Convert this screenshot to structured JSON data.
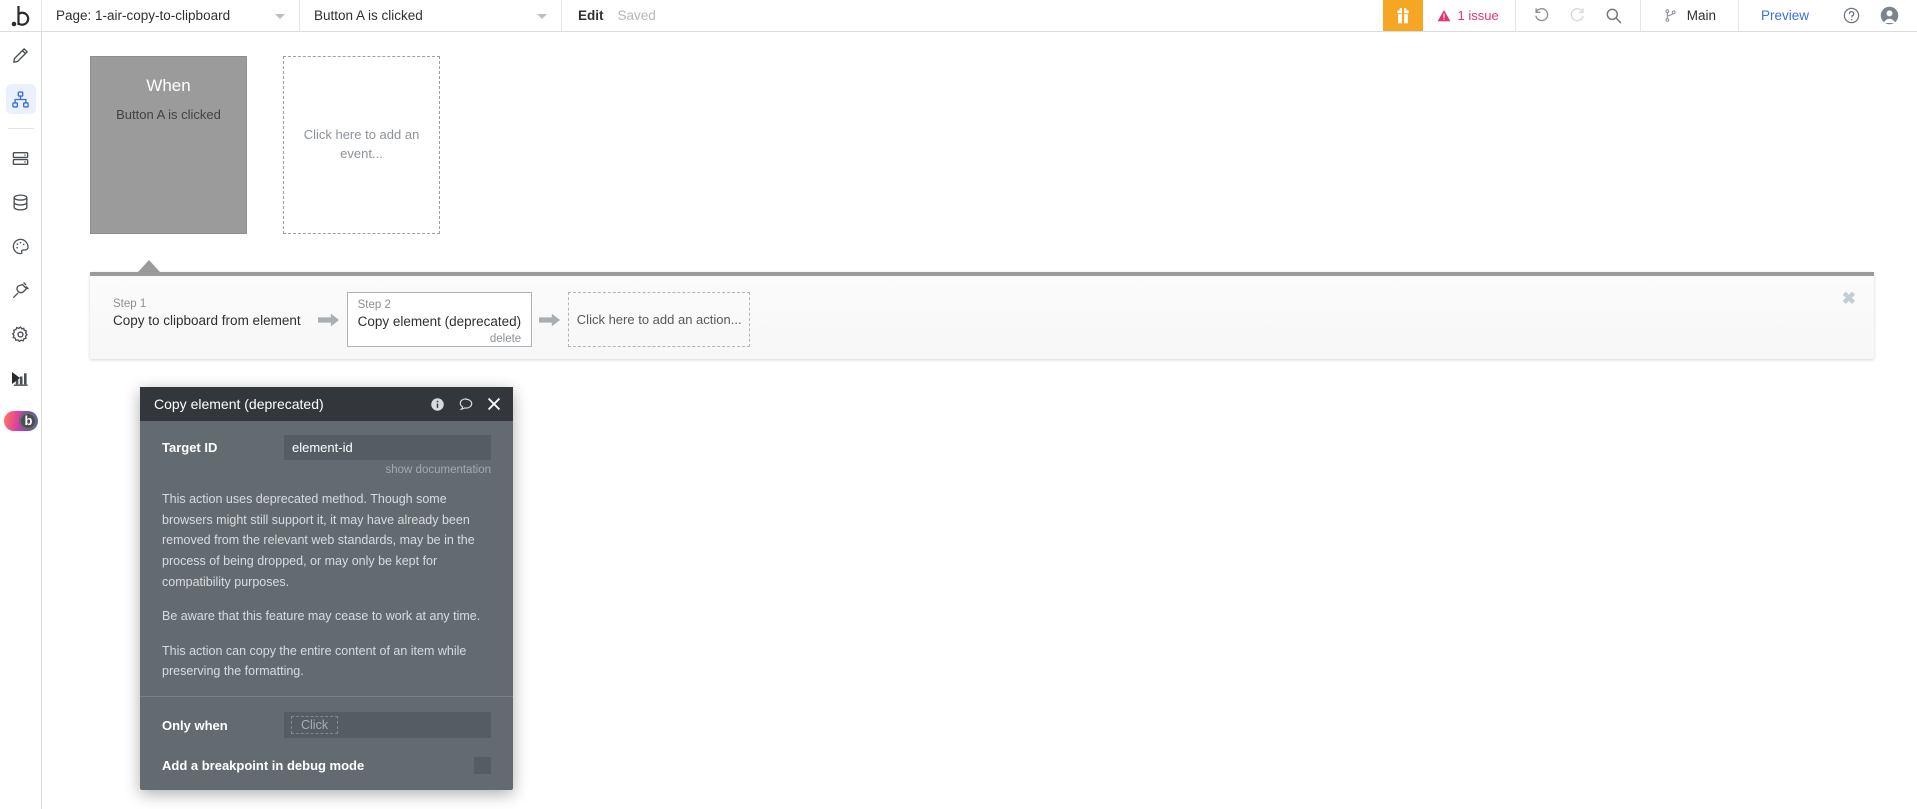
{
  "topbar": {
    "logo_glyph": ".b",
    "page_label": "Page: 1-air-copy-to-clipboard",
    "event_label": "Button A is clicked",
    "edit_label": "Edit",
    "saved_label": "Saved",
    "gift_icon": "gift-icon",
    "issue_text": "1 issue",
    "warning_icon": "warning-triangle-icon",
    "undo_icon": "undo-icon",
    "redo_icon": "redo-icon",
    "search_icon": "search-icon",
    "branch_icon": "git-branch-icon",
    "branch_name": "Main",
    "preview_label": "Preview",
    "help_icon": "help-circle-icon",
    "account_icon": "user-avatar-icon",
    "accent_orange": "#f5a623",
    "accent_pink": "#e8336d",
    "accent_blue": "#3a6fd8"
  },
  "sidebar": {
    "items": [
      {
        "name": "design",
        "icon": "pencil-icon",
        "active": false
      },
      {
        "name": "workflow",
        "icon": "workflow-nodes-icon",
        "active": true
      },
      {
        "name": "data-layers",
        "icon": "layers-icon",
        "active": false
      },
      {
        "name": "database",
        "icon": "database-icon",
        "active": false
      },
      {
        "name": "styles",
        "icon": "palette-icon",
        "active": false
      },
      {
        "name": "plugins",
        "icon": "plug-icon",
        "active": false
      },
      {
        "name": "settings",
        "icon": "gear-icon",
        "active": false
      },
      {
        "name": "logs",
        "icon": "bar-chart-icon",
        "active": false
      }
    ],
    "logo_toggle": "bubble-logo-toggle",
    "expander_icon": "expand-panel-arrow-icon"
  },
  "canvas": {
    "event": {
      "when_title": "When",
      "when_subtitle": "Button A is clicked"
    },
    "add_event_placeholder": "Click here to add an event..."
  },
  "actions": {
    "close_icon": "close-icon",
    "steps": [
      {
        "num": "Step 1",
        "name": "Copy to clipboard from element",
        "boxed": false,
        "delete": ""
      },
      {
        "num": "Step 2",
        "name": "Copy element (deprecated)",
        "boxed": true,
        "delete": "delete"
      }
    ],
    "arrow_icon": "arrow-right-icon",
    "add_action_placeholder": "Click here to add an action..."
  },
  "dialog": {
    "title": "Copy element (deprecated)",
    "info_icon": "info-circle-icon",
    "comment_icon": "comment-bubble-icon",
    "close_icon": "close-icon",
    "target_id_label": "Target ID",
    "target_id_value": "element-id",
    "show_documentation": "show documentation",
    "description": [
      "This action uses deprecated method. Though some browsers might still support it, it may have already been removed from the relevant web standards, may be in the process of being dropped, or may only be kept for compatibility purposes.",
      "Be aware that this feature may cease to work at any time.",
      "This action can copy the entire content of an item while preserving the formatting."
    ],
    "only_when_label": "Only when",
    "only_when_chip": "Click",
    "breakpoint_label": "Add a breakpoint in debug mode",
    "breakpoint_checked": false
  }
}
